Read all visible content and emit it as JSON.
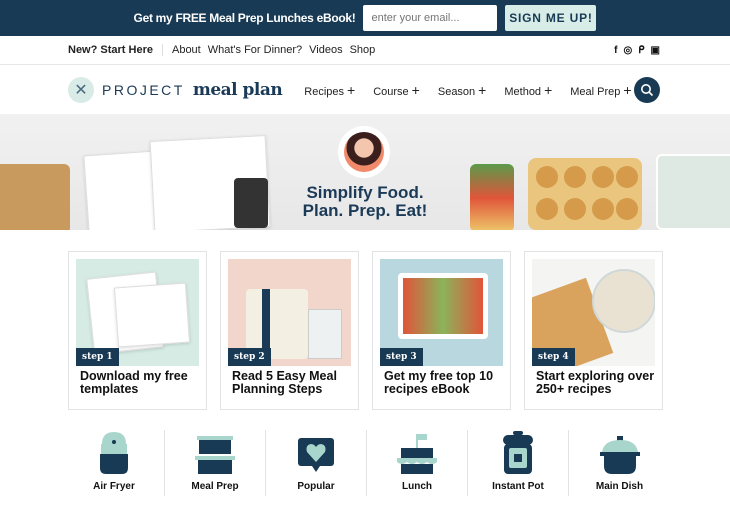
{
  "promo": {
    "text": "Get my FREE Meal Prep Lunches eBook!",
    "email_placeholder": "enter your email...",
    "button": "SIGN ME UP!"
  },
  "topnav": {
    "start": "New? Start Here",
    "links": [
      "About",
      "What's For Dinner?",
      "Videos",
      "Shop"
    ],
    "social": [
      "facebook-icon",
      "instagram-icon",
      "pinterest-icon",
      "youtube-icon"
    ]
  },
  "logo": {
    "part1": "PROJECT",
    "part2": "meal plan"
  },
  "menu": [
    {
      "label": "Recipes"
    },
    {
      "label": "Course"
    },
    {
      "label": "Season"
    },
    {
      "label": "Method"
    },
    {
      "label": "Meal Prep"
    }
  ],
  "hero": {
    "line1": "Simplify Food.",
    "line2": "Plan. Prep. Eat!"
  },
  "cards": [
    {
      "step": "step 1",
      "title": "Download my free templates",
      "bg": "#d5ebe3"
    },
    {
      "step": "step 2",
      "title": "Read 5 Easy Meal Planning Steps",
      "bg": "#f2d6cc"
    },
    {
      "step": "step 3",
      "title": "Get my free top 10 recipes eBook",
      "bg": "#b9d7df"
    },
    {
      "step": "step 4",
      "title": "Start exploring over 250+ recipes",
      "bg": "#f4f4f2"
    }
  ],
  "categories": [
    {
      "label": "Air Fryer"
    },
    {
      "label": "Meal Prep"
    },
    {
      "label": "Popular"
    },
    {
      "label": "Lunch"
    },
    {
      "label": "Instant Pot"
    },
    {
      "label": "Main Dish"
    }
  ],
  "colors": {
    "navy": "#183a55",
    "mint": "#a9d6cc"
  }
}
